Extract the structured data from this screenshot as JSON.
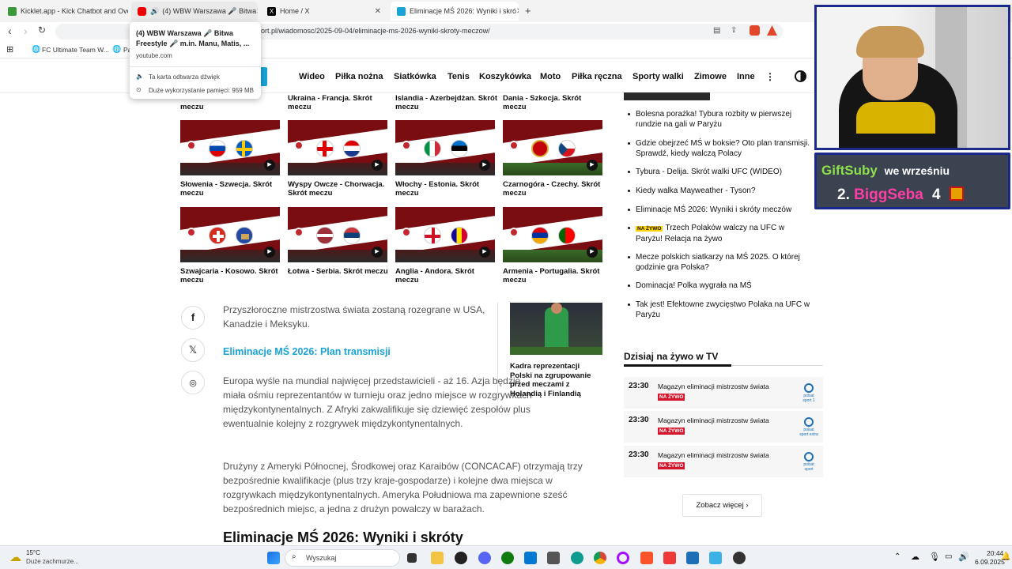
{
  "browser": {
    "tabs": [
      {
        "label": "Kicklet.app - Kick Chatbot and Overl"
      },
      {
        "label": "(4) WBW Warszawa 🎤 Bitwa"
      },
      {
        "label": "Home / X"
      },
      {
        "label": "Eliminacje MŚ 2026: Wyniki i skró"
      }
    ],
    "url": "ort.pl/wiadomosc/2025-09-04/eliminacje-ms-2026-wyniki-skroty-meczow/",
    "bookmarks": [
      {
        "label": "FC Ultimate Team W..."
      },
      {
        "label": "Pa"
      }
    ],
    "tooltip": {
      "title": "(4) WBW Warszawa 🎤 Bitwa Freestyle 🎤 m.in. Manu, Matis, ...",
      "domain": "youtube.com",
      "audio": "Ta karta odtwarza dźwięk",
      "memory": "Duże wykorzystanie pamięci: 959 MB"
    }
  },
  "nav": {
    "items": [
      "Wideo",
      "Piłka nożna",
      "Siatkówka",
      "Tenis",
      "Koszykówka",
      "Moto",
      "Piłka ręczna",
      "Sporty walki",
      "Zimowe",
      "Inne"
    ]
  },
  "grid": {
    "top_partial": [
      {
        "title": "meczu"
      },
      {
        "title": "Ukraina - Francja. Skrót meczu"
      },
      {
        "title": "Islandia - Azerbejdżan. Skrót meczu"
      },
      {
        "title": "Dania - Szkocja. Skrót meczu"
      }
    ],
    "row1": [
      {
        "title": "Słowenia - Szwecja. Skrót meczu"
      },
      {
        "title": "Wyspy Owcze - Chorwacja. Skrót meczu"
      },
      {
        "title": "Włochy - Estonia. Skrót meczu"
      },
      {
        "title": "Czarnogóra - Czechy. Skrót meczu"
      }
    ],
    "row2": [
      {
        "title": "Szwajcaria - Kosowo. Skrót meczu"
      },
      {
        "title": "Łotwa - Serbia. Skrót meczu"
      },
      {
        "title": "Anglia - Andora. Skrót meczu"
      },
      {
        "title": "Armenia - Portugalia. Skrót meczu"
      }
    ]
  },
  "article": {
    "p1": "Przyszłoroczne mistrzostwa świata zostaną rozegrane w USA, Kanadzie i Meksyku.",
    "link": "Eliminacje MŚ 2026: Plan transmisji",
    "p2": "Europa wyśle na mundial najwięcej przedstawicieli - aż 16. Azja będzie miała ośmiu reprezentantów w turnieju oraz jedno miejsce w rozgrywkach międzykontynentalnych. Z Afryki zakwalifikuje się dziewięć zespołów plus ewentualnie kolejny z rozgrywek międzykontynentalnych.",
    "p3": "Drużyny z Ameryki Północnej, Środkowej oraz Karaibów (CONCACAF) otrzymają trzy bezpośrednie kwalifikacje (plus trzy kraje-gospodarze) i kolejne dwa miejsca w rozgrywkach międzykontynentalnych. Ameryka Południowa ma zapewnione sześć bezpośrednich miejsc, a jedna z drużyn powalczy w barażach.",
    "heading": "Eliminacje MŚ 2026: Wyniki i skróty",
    "related_caption": "Kadra reprezentacji Polski na zgrupowanie przed meczami z Holandią i Finlandią"
  },
  "sidebar": {
    "news": [
      {
        "title": "Bolesna porażka! Tybura rozbity w pierwszej rundzie na gali w Paryżu",
        "badge": ""
      },
      {
        "title": "Gdzie obejrzeć MŚ w boksie? Oto plan transmisji. Sprawdź, kiedy walczą Polacy",
        "badge": ""
      },
      {
        "title": "Tybura - Delija. Skrót walki UFC (WIDEO)",
        "badge": ""
      },
      {
        "title": "Kiedy walka Mayweather - Tyson?",
        "badge": ""
      },
      {
        "title": "Eliminacje MŚ 2026: Wyniki i skróty meczów",
        "badge": ""
      },
      {
        "title": "Trzech Polaków walczy na UFC w Paryżu! Relacja na żywo",
        "badge": "NA ŻYWO"
      },
      {
        "title": "Mecze polskich siatkarzy na MŚ 2025. O której godzinie gra Polska?",
        "badge": ""
      },
      {
        "title": "Dominacja! Polka wygrała na MŚ",
        "badge": ""
      },
      {
        "title": "Tak jest! Efektowne zwycięstwo Polaka na UFC w Paryżu",
        "badge": ""
      }
    ],
    "tv_header": "Dzisiaj na żywo w TV",
    "tv": [
      {
        "time": "23:30",
        "name": "Magazyn eliminacji mistrzostw świata",
        "badge": "NA ŻYWO",
        "channel": "polsat sport 1"
      },
      {
        "time": "23:30",
        "name": "Magazyn eliminacji mistrzostw świata",
        "badge": "NA ŻYWO",
        "channel": "polsat sport extra"
      },
      {
        "time": "23:30",
        "name": "Magazyn eliminacji mistrzostw świata",
        "badge": "NA ŻYWO",
        "channel": "polsat sport"
      }
    ],
    "more": "Zobacz więcej"
  },
  "overlay": {
    "line1_a": "GiftSuby",
    "line1_b": "we wrześniu",
    "rank": "2.",
    "name": "BiggSeba",
    "count": "4"
  },
  "taskbar": {
    "weather_temp": "15°C",
    "weather_desc": "Duże zachmurze...",
    "search": "Wyszukaj",
    "time": "20:44",
    "date": "6.09.2025"
  },
  "colors": {
    "accent_link": "#1aa3d6",
    "live_red": "#d4142a",
    "overlay_green": "#8ee04a",
    "overlay_pink": "#ff3ea5"
  }
}
